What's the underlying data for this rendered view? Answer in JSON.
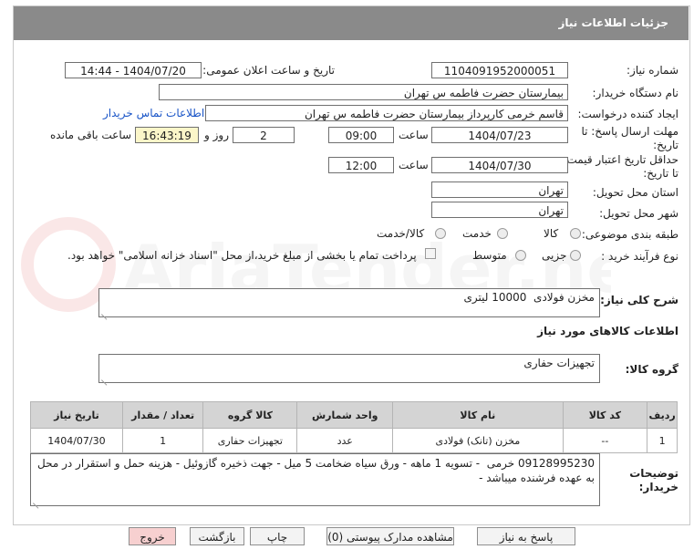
{
  "header": {
    "title": "جزئیات اطلاعات نیاز"
  },
  "fields": {
    "need_number": {
      "label": "شماره نیاز:",
      "value": "1104091952000051"
    },
    "announce": {
      "label": "تاریخ و ساعت اعلان عمومی:",
      "value": "1404/07/20 - 14:44"
    },
    "buyer": {
      "label": "نام دستگاه خریدار:",
      "value": "بیمارستان حضرت فاطمه س  تهران"
    },
    "creator": {
      "label": "ایجاد کننده درخواست:",
      "value": "قاسم خرمی کارپرداز بیمارستان حضرت فاطمه س  تهران",
      "link": "اطلاعات تماس خریدار"
    },
    "reply_deadline": {
      "label": "مهلت ارسال پاسخ: تا تاریخ:",
      "date": "1404/07/23",
      "time_label": "ساعت",
      "time": "09:00",
      "days": "2",
      "days_label": "روز و",
      "remaining": "16:43:19",
      "remaining_label": "ساعت باقی مانده"
    },
    "price_validity": {
      "label": "حداقل تاریخ اعتبار قیمت: تا تاریخ:",
      "date": "1404/07/30",
      "time_label": "ساعت",
      "time": "12:00"
    },
    "province": {
      "label": "استان محل تحویل:",
      "value": "تهران"
    },
    "city": {
      "label": "شهر محل تحویل:",
      "value": "تهران"
    },
    "category": {
      "label": "طبقه بندی موضوعی:",
      "options": [
        "کالا",
        "خدمت",
        "کالا/خدمت"
      ]
    },
    "process": {
      "label": "نوع فرآیند خرید :",
      "options": [
        "جزیی",
        "متوسط"
      ],
      "payment_note": "پرداخت تمام یا بخشی از مبلغ خرید،از محل \"اسناد خزانه اسلامی\" خواهد بود."
    }
  },
  "description": {
    "label": "شرح کلی نیاز:",
    "value": "مخزن فولادی  10000 لیتری"
  },
  "goods_info": {
    "label": "اطلاعات کالاهای مورد نیاز"
  },
  "goods_group": {
    "label": "گروه کالا:",
    "value": "تجهیزات حفاری"
  },
  "table": {
    "headers": [
      "ردیف",
      "کد کالا",
      "نام کالا",
      "واحد شمارش",
      "کالا گروه",
      "تعداد / مقدار",
      "تاریخ نیاز"
    ],
    "rows": [
      [
        "1",
        "--",
        "مخزن (تانک) فولادی",
        "عدد",
        "تجهیزات حفاری",
        "1",
        "1404/07/30"
      ]
    ]
  },
  "buyer_notes": {
    "label": "توضیحات خریدار:",
    "value": "09128995230 خرمی  - تسویه 1 ماهه - ورق سیاه ضخامت 5 میل - جهت ذخیره گازوئیل - هزینه حمل و استقرار در محل به عهده فرشنده میباشد -"
  },
  "buttons": {
    "reply": "پاسخ به نیاز",
    "attachments": "مشاهده مدارک پیوستی (0)",
    "print": "چاپ",
    "back": "بازگشت",
    "exit": "خروج"
  },
  "watermark": "AriaTender.net"
}
